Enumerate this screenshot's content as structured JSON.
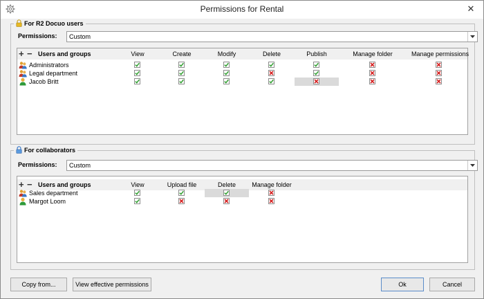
{
  "window": {
    "title": "Permissions for Rental",
    "close_symbol": "✕"
  },
  "r2": {
    "legend": "For R2 Docuo users",
    "permissions_label": "Permissions:",
    "permissions_value": "Custom",
    "columns": [
      "Users and groups",
      "View",
      "Create",
      "Modify",
      "Delete",
      "Publish",
      "Manage folder",
      "Manage permissions"
    ],
    "rows": [
      {
        "name": "Administrators",
        "icon": "group-icon",
        "values": [
          true,
          true,
          true,
          true,
          true,
          false,
          false
        ]
      },
      {
        "name": "Legal department",
        "icon": "group-icon",
        "values": [
          true,
          true,
          true,
          false,
          true,
          false,
          false
        ]
      },
      {
        "name": "Jacob Britt",
        "icon": "user-icon",
        "values": [
          true,
          true,
          true,
          true,
          false,
          false,
          false
        ]
      }
    ]
  },
  "collab": {
    "legend": "For collaborators",
    "permissions_label": "Permissions:",
    "permissions_value": "Custom",
    "columns": [
      "Users and groups",
      "View",
      "Upload file",
      "Delete",
      "Manage folder"
    ],
    "rows": [
      {
        "name": "Sales department",
        "icon": "group-icon",
        "values": [
          true,
          true,
          true,
          false
        ]
      },
      {
        "name": "Margot Loom",
        "icon": "user-icon",
        "values": [
          true,
          false,
          false,
          false
        ]
      }
    ]
  },
  "buttons": {
    "copy_from": "Copy from...",
    "view_effective": "View effective permissions",
    "ok": "Ok",
    "cancel": "Cancel"
  },
  "colors": {
    "check": "#2e9e2e",
    "cross": "#d42020",
    "highlight": "#dadada"
  }
}
